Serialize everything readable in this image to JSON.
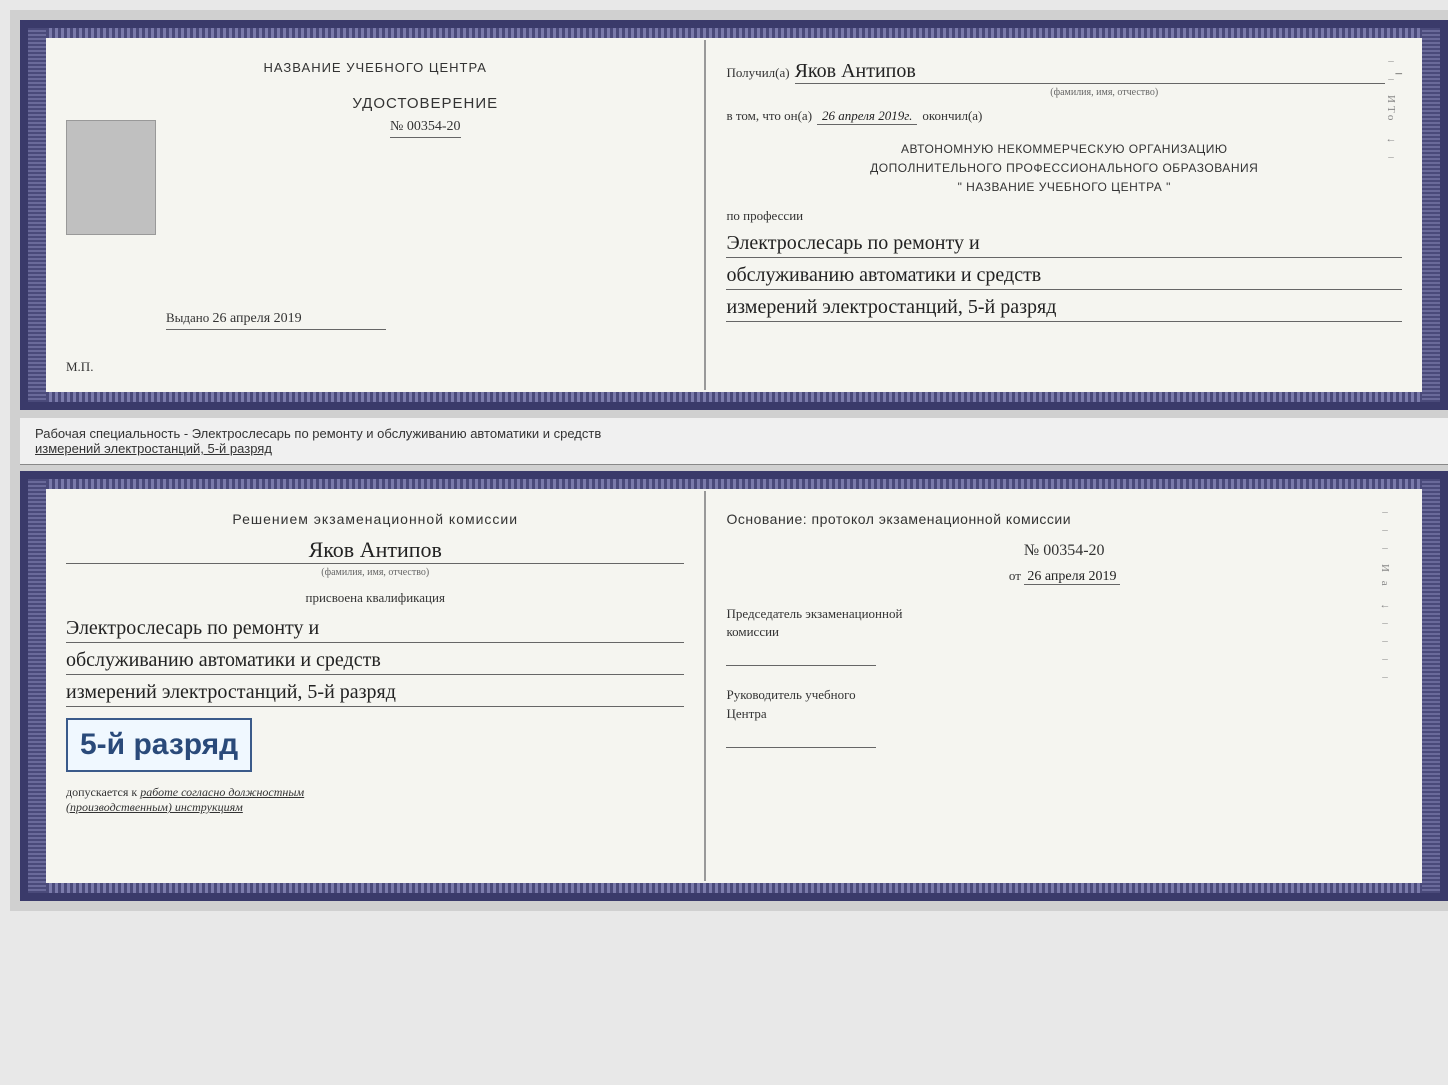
{
  "document": {
    "background_color": "#d0d0d0",
    "top_cert": {
      "left_page": {
        "top_title": "НАЗВАНИЕ УЧЕБНОГО ЦЕНТРА",
        "cert_title": "УДОСТОВЕРЕНИЕ",
        "cert_number": "№ 00354-20",
        "issued_label": "Выдано",
        "issued_date": "26 апреля 2019",
        "mp_label": "М.П."
      },
      "right_page": {
        "received_label": "Получил(а)",
        "recipient_name": "Яков Антипов",
        "fio_label": "(фамилия, имя, отчество)",
        "date_preamble": "в том, что он(а)",
        "date_value": "26 апреля 2019г.",
        "finished_label": "окончил(а)",
        "org_line1": "АВТОНОМНУЮ НЕКОММЕРЧЕСКУЮ ОРГАНИЗАЦИЮ",
        "org_line2": "ДОПОЛНИТЕЛЬНОГО ПРОФЕССИОНАЛЬНОГО ОБРАЗОВАНИЯ",
        "org_line3": "\"  НАЗВАНИЕ УЧЕБНОГО ЦЕНТРА  \"",
        "profession_label": "по профессии",
        "profession_line1": "Электрослесарь по ремонту и",
        "profession_line2": "обслуживанию автоматики и средств",
        "profession_line3": "измерений электростанций, 5-й разряд"
      }
    },
    "middle_text": {
      "line1": "Рабочая специальность - Электрослесарь по ремонту и обслуживанию автоматики и средств",
      "line2": "измерений электростанций, 5-й разряд"
    },
    "bottom_cert": {
      "left_page": {
        "decision_text": "Решением экзаменационной комиссии",
        "person_name": "Яков Антипов",
        "fio_label": "(фамилия, имя, отчество)",
        "qualification_label": "присвоена квалификация",
        "qualification_line1": "Электрослесарь по ремонту и",
        "qualification_line2": "обслуживанию автоматики и средств",
        "qualification_line3": "измерений электростанций, 5-й разряд",
        "rank_text": "5-й разряд",
        "allowed_prefix": "допускается к",
        "allowed_text": "работе согласно должностным",
        "allowed_text2": "(производственным) инструкциям"
      },
      "right_page": {
        "basis_label": "Основание: протокол экзаменационной комиссии",
        "protocol_number": "№  00354-20",
        "date_from_label": "от",
        "date_from_value": "26 апреля 2019",
        "chairman_title_line1": "Председатель экзаменационной",
        "chairman_title_line2": "комиссии",
        "director_title_line1": "Руководитель учебного",
        "director_title_line2": "Центра"
      }
    }
  }
}
